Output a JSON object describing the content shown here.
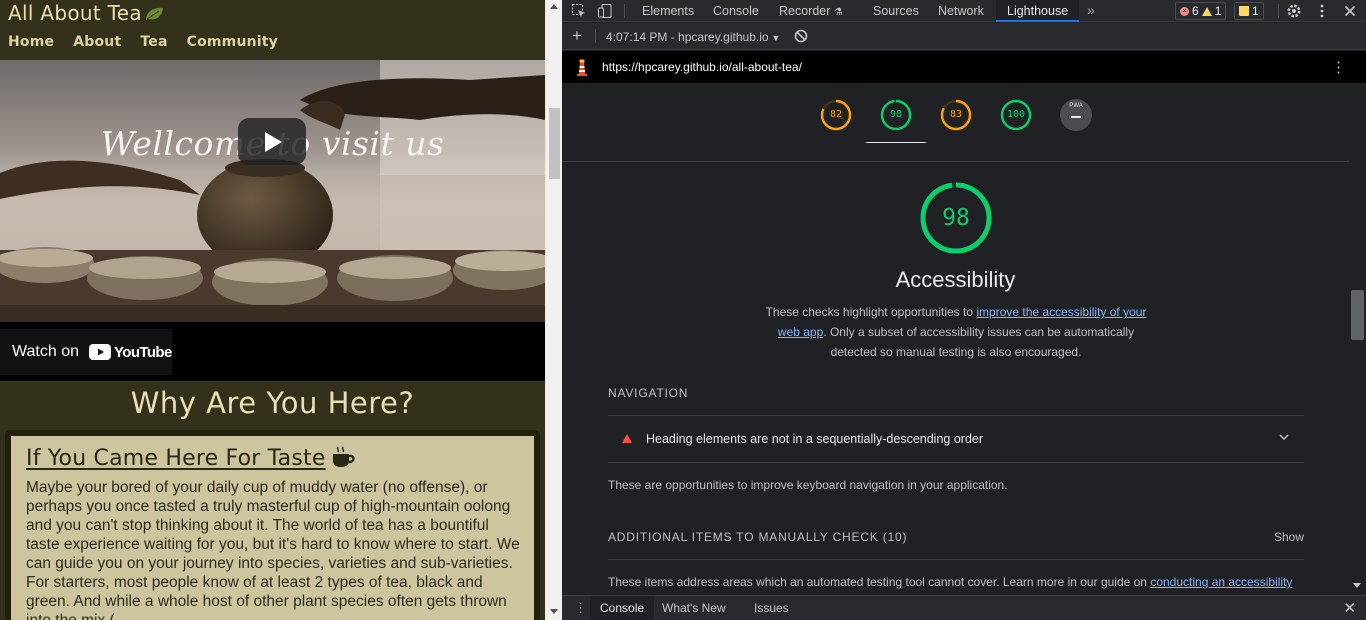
{
  "site": {
    "title": "All About Tea",
    "nav": [
      "Home",
      "About",
      "Tea",
      "Community"
    ],
    "video": {
      "caption": "Wellcome to visit us",
      "watch_on": "Watch on",
      "youtube": "YouTube"
    },
    "section_heading": "Why Are You Here?",
    "card": {
      "title": "If You Came Here For Taste",
      "body": "Maybe your bored of your daily cup of muddy water (no offense), or perhaps you once tasted a truly masterful cup of high-mountain oolong and you can't stop thinking about it. The world of tea has a bountiful taste experience waiting for you, but it's hard to know where to start. We can guide you on your journey into species, varieties and sub-varieties. For starters, most people know of at least 2 types of tea, black and green. And while a whole host of other plant species often gets thrown into the mix ("
    }
  },
  "devtools": {
    "tabs": [
      "Elements",
      "Console",
      "Recorder",
      "Sources",
      "Network",
      "Lighthouse"
    ],
    "active_tab": "Lighthouse",
    "more_tabs": "»",
    "badges": {
      "errors": "6",
      "warnings": "1",
      "issues": "1"
    },
    "report_select": "4:07:14 PM - hpcarey.github.io",
    "url": "https://hpcarey.github.io/all-about-tea/",
    "scores": [
      {
        "value": "82",
        "color": "#ffa400"
      },
      {
        "value": "98",
        "color": "#0cce6b"
      },
      {
        "value": "83",
        "color": "#ffa400"
      },
      {
        "value": "100",
        "color": "#0cce6b"
      }
    ],
    "pwa_label": "PWA",
    "category": {
      "score": "98",
      "score_value": 98,
      "color": "#0cce6b",
      "title": "Accessibility",
      "desc_before": "These checks highlight opportunities to ",
      "desc_link": "improve the accessibility of your web app",
      "desc_after": ". Only a subset of accessibility issues can be automatically detected so manual testing is also encouraged."
    },
    "navigation": {
      "title": "NAVIGATION",
      "audit": "Heading elements are not in a sequentially-descending order",
      "description": "These are opportunities to improve keyboard navigation in your application."
    },
    "manual": {
      "title": "ADDITIONAL ITEMS TO MANUALLY CHECK (10)",
      "show": "Show",
      "desc_before": "These items address areas which an automated testing tool cannot cover. Learn more in our guide on ",
      "desc_link": "conducting an accessibility"
    },
    "drawer_tabs": [
      "Console",
      "What's New",
      "Issues"
    ]
  }
}
